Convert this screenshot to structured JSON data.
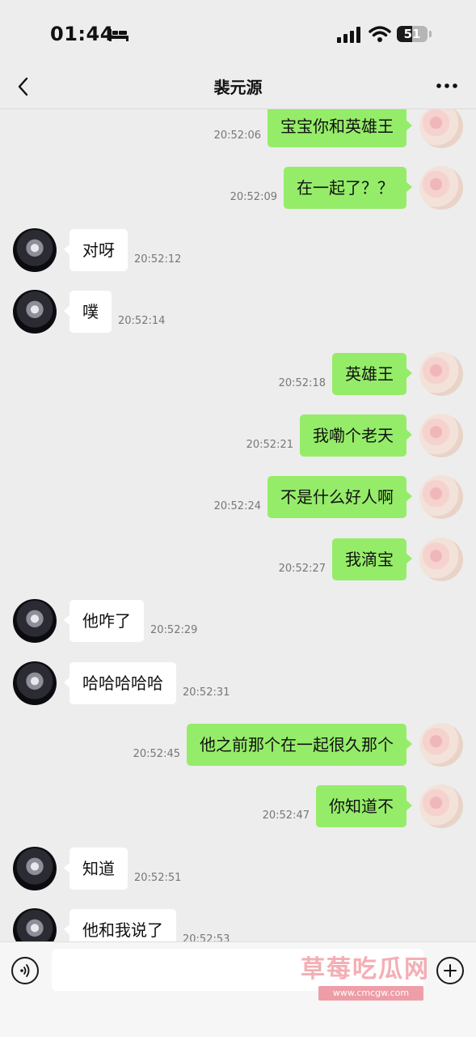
{
  "status_bar": {
    "time": "01:44",
    "battery": "51",
    "battery_level": 0.51
  },
  "nav": {
    "title": "裴元源"
  },
  "messages": [
    {
      "side": "right",
      "text": "宝宝你和英雄王",
      "time": "20:52:06"
    },
    {
      "side": "right",
      "text": "在一起了？？",
      "time": "20:52:09"
    },
    {
      "side": "left",
      "text": "对呀",
      "time": "20:52:12"
    },
    {
      "side": "left",
      "text": "噗",
      "time": "20:52:14"
    },
    {
      "side": "right",
      "text": "英雄王",
      "time": "20:52:18"
    },
    {
      "side": "right",
      "text": "我嘞个老天",
      "time": "20:52:21"
    },
    {
      "side": "right",
      "text": "不是什么好人啊",
      "time": "20:52:24"
    },
    {
      "side": "right",
      "text": "我滴宝",
      "time": "20:52:27"
    },
    {
      "side": "left",
      "text": "他咋了",
      "time": "20:52:29"
    },
    {
      "side": "left",
      "text": "哈哈哈哈哈",
      "time": "20:52:31"
    },
    {
      "side": "right",
      "text": "他之前那个在一起很久那个",
      "time": "20:52:45"
    },
    {
      "side": "right",
      "text": "你知道不",
      "time": "20:52:47"
    },
    {
      "side": "left",
      "text": "知道",
      "time": "20:52:51"
    },
    {
      "side": "left",
      "text": "他和我说了",
      "time": "20:52:53"
    }
  ],
  "watermark": {
    "text": "草莓吃瓜网",
    "url": "www.cmcgw.com"
  },
  "icons": {
    "back": "chevron-left-icon",
    "more": "more-horizontal-icon",
    "voice": "voice-icon",
    "plus": "plus-icon",
    "sleep": "bed-icon",
    "signal": "signal-icon",
    "wifi": "wifi-icon",
    "battery": "battery-icon"
  },
  "colors": {
    "bubble_sent": "#95ec69",
    "bubble_received": "#ffffff",
    "background": "#ededed"
  }
}
